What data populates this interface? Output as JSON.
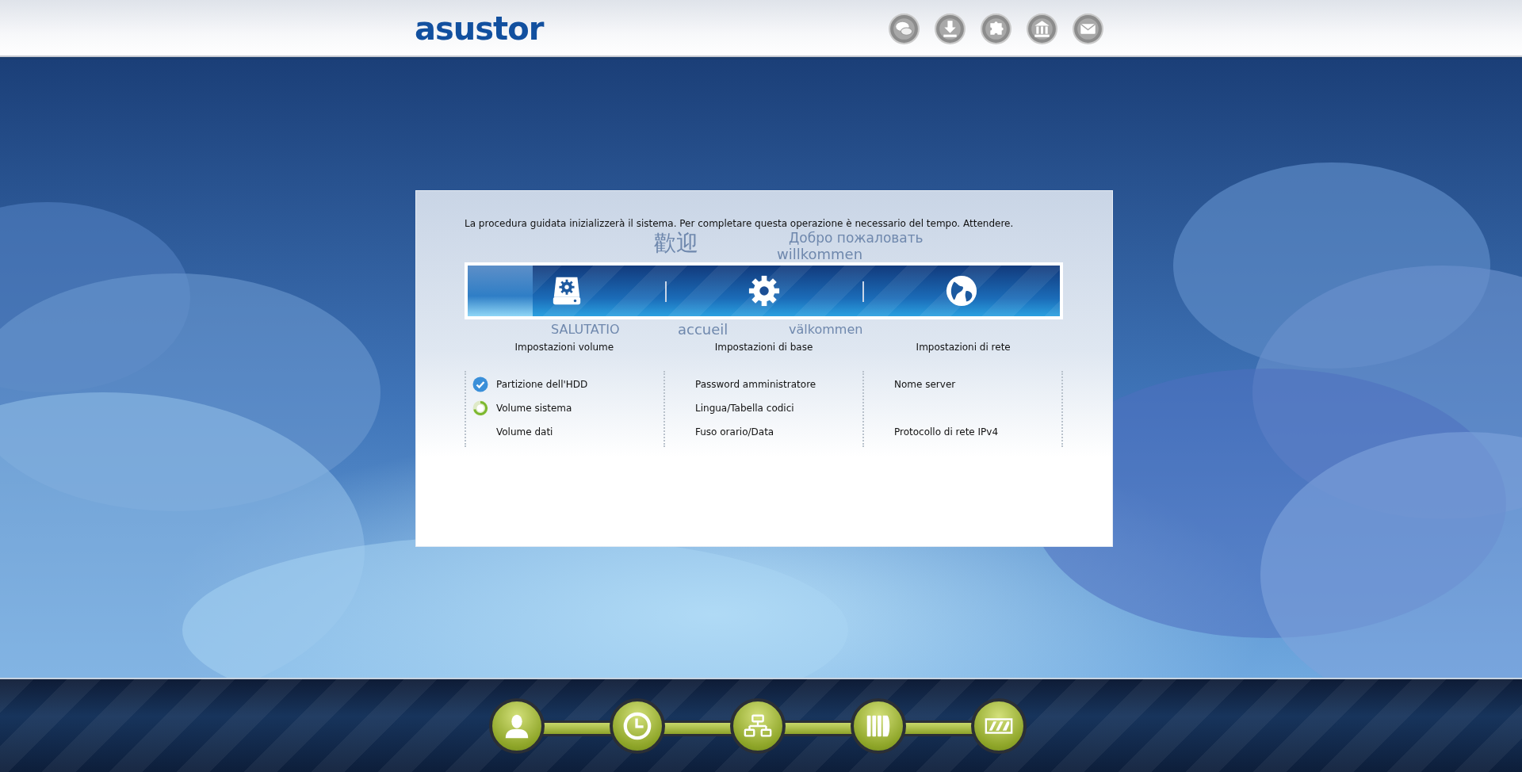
{
  "header": {
    "logo": "asustor"
  },
  "dialog": {
    "message": "La procedura guidata inizializzerà il sistema. Per completare questa operazione è necessario del tempo. Attendere.",
    "background_words": [
      "歡迎",
      "Добро пожаловать",
      "willkommen",
      "SALUTATIO",
      "accueil",
      "välkommen"
    ],
    "progress": {
      "level": 0.11
    },
    "steps": [
      {
        "label": "Impostazioni volume",
        "items": [
          {
            "kind": "done",
            "label": "Partizione dell'HDD"
          },
          {
            "kind": "current",
            "label": "Volume sistema"
          },
          {
            "kind": "todo",
            "label": "Volume dati"
          }
        ]
      },
      {
        "label": "Impostazioni di base",
        "items": [
          {
            "kind": "todo",
            "label": "Password amministratore"
          },
          {
            "kind": "todo",
            "label": "Lingua/Tabella codici"
          },
          {
            "kind": "todo",
            "label": "Fuso orario/Data"
          }
        ]
      },
      {
        "label": "Impostazioni di rete",
        "items": [
          {
            "kind": "todo",
            "label": "Nome server"
          },
          {
            "kind": "gap"
          },
          {
            "kind": "todo",
            "label": "Protocollo di rete IPv4"
          }
        ]
      }
    ]
  }
}
